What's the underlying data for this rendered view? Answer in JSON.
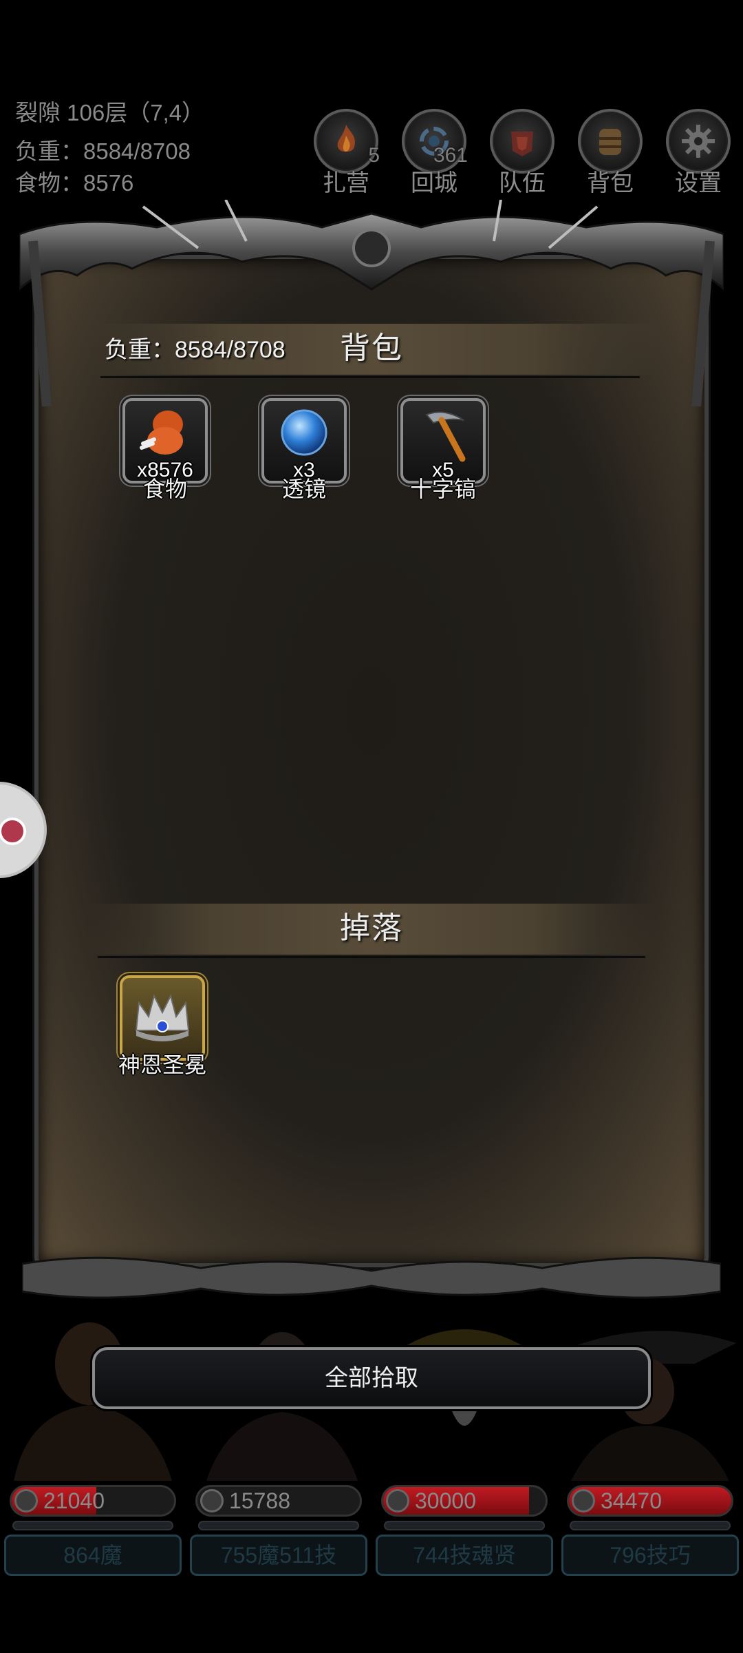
{
  "status": {
    "location": "裂隙 106层（7,4）",
    "load": "负重：8584/8708",
    "food": "食物：8576"
  },
  "topnav": [
    {
      "label": "扎营",
      "badge": "5",
      "icon": "campfire-icon"
    },
    {
      "label": "回城",
      "badge": "361",
      "icon": "portal-icon"
    },
    {
      "label": "队伍",
      "badge": "",
      "icon": "team-icon"
    },
    {
      "label": "背包",
      "badge": "",
      "icon": "backpack-icon"
    },
    {
      "label": "设置",
      "badge": "",
      "icon": "gear-icon"
    }
  ],
  "backpack": {
    "title": "背包",
    "load": "负重：8584/8708",
    "items": [
      {
        "name": "食物",
        "qty": "x8576",
        "icon": "meat-icon"
      },
      {
        "name": "透镜",
        "qty": "x3",
        "icon": "lens-icon"
      },
      {
        "name": "十字镐",
        "qty": "x5",
        "icon": "pickaxe-icon"
      }
    ]
  },
  "drops": {
    "title": "掉落",
    "items": [
      {
        "name": "神恩圣冕",
        "icon": "crown-icon"
      }
    ]
  },
  "pickup_all": "全部拾取",
  "heroes": [
    {
      "hp": "21040",
      "hp_fill": 0.52,
      "skill": "864魔"
    },
    {
      "hp": "15788",
      "hp_fill": 0.0,
      "skill": "755魔511技"
    },
    {
      "hp": "30000",
      "hp_fill": 0.9,
      "skill": "744技魂贤"
    },
    {
      "hp": "34470",
      "hp_fill": 1.0,
      "skill": "796技巧"
    }
  ],
  "colors": {
    "hp_red": "#c11a22",
    "parchment": "#23201b",
    "gold_frame": "#c9a64a"
  }
}
